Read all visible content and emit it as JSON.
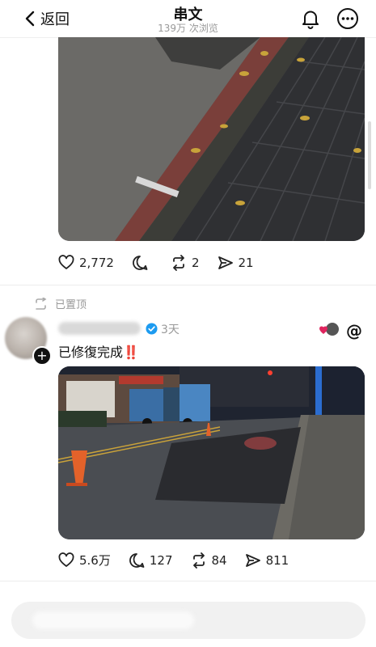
{
  "header": {
    "back_label": "返回",
    "title": "串文",
    "views": "139万 次浏览",
    "icons": [
      "back-chevron-icon",
      "bell-icon",
      "more-icon"
    ]
  },
  "post1": {
    "likes": "2,772",
    "reposts": "2",
    "shares": "21",
    "comments": ""
  },
  "post2": {
    "repost_label": "已置顶",
    "time": "3天",
    "text": "已修復完成‼️",
    "likes": "5.6万",
    "comments": "127",
    "reposts": "84",
    "shares": "811"
  },
  "colors": {
    "verified": "#1d9bf0",
    "alert": "#e0245e"
  }
}
